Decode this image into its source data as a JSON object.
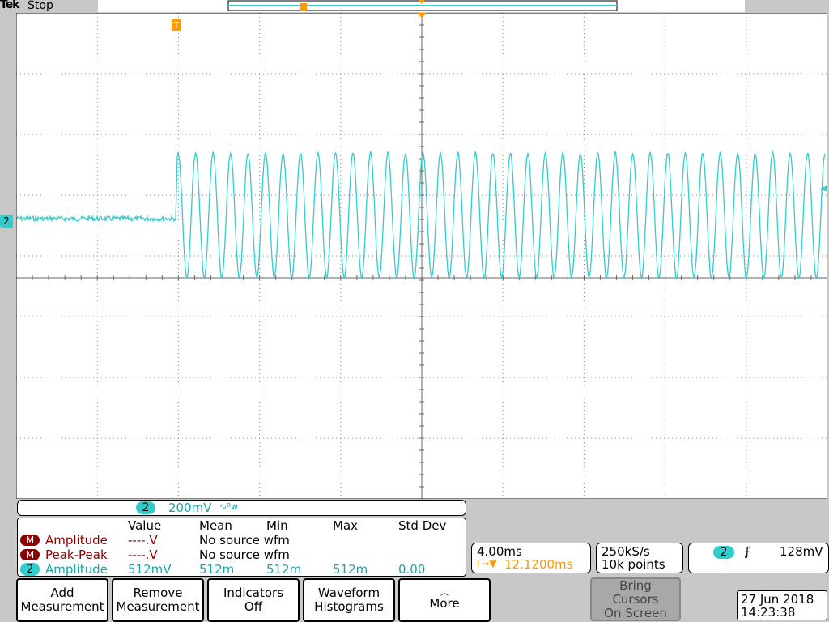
{
  "header": {
    "brand": "Tek",
    "run_state": "Stop"
  },
  "trigger_marker": "T",
  "channel_marker": "2",
  "channel_scale": {
    "channel": "2",
    "scale": "200mV",
    "coupling_symbol": "∿ᴮw"
  },
  "measurements": {
    "headers": [
      "Value",
      "Mean",
      "Min",
      "Max",
      "Std Dev"
    ],
    "rows": [
      {
        "badge": "M",
        "name": "Amplitude",
        "value": "----.V",
        "mean": "No source wfm",
        "min": "",
        "max": "",
        "std": ""
      },
      {
        "badge": "M",
        "name": "Peak-Peak",
        "value": "----.V",
        "mean": "No source wfm",
        "min": "",
        "max": "",
        "std": ""
      },
      {
        "badge": "2",
        "name": "Amplitude",
        "value": "512mV",
        "mean": "512m",
        "min": "512m",
        "max": "512m",
        "std": "0.00"
      }
    ]
  },
  "timebase": {
    "scale": "4.00ms",
    "delay": "12.1200ms",
    "delay_prefix": "T→▼"
  },
  "acquisition": {
    "rate": "250kS/s",
    "points": "10k points"
  },
  "trigger": {
    "channel": "2",
    "slope_symbol": "⨍",
    "level": "128mV"
  },
  "buttons": {
    "add": [
      "Add",
      "Measurement"
    ],
    "remove": [
      "Remove",
      "Measurement"
    ],
    "indicators": [
      "Indicators",
      "Off"
    ],
    "histograms": [
      "Waveform",
      "Histograms"
    ],
    "more": [
      "More"
    ],
    "cursors": [
      "Bring",
      "Cursors",
      "On Screen"
    ]
  },
  "datetime": {
    "date": "27 Jun 2018",
    "time": "14:23:38"
  },
  "colors": {
    "trace": "#33cccc",
    "trigger": "#ff9900",
    "measure_red": "#8b0000"
  }
}
